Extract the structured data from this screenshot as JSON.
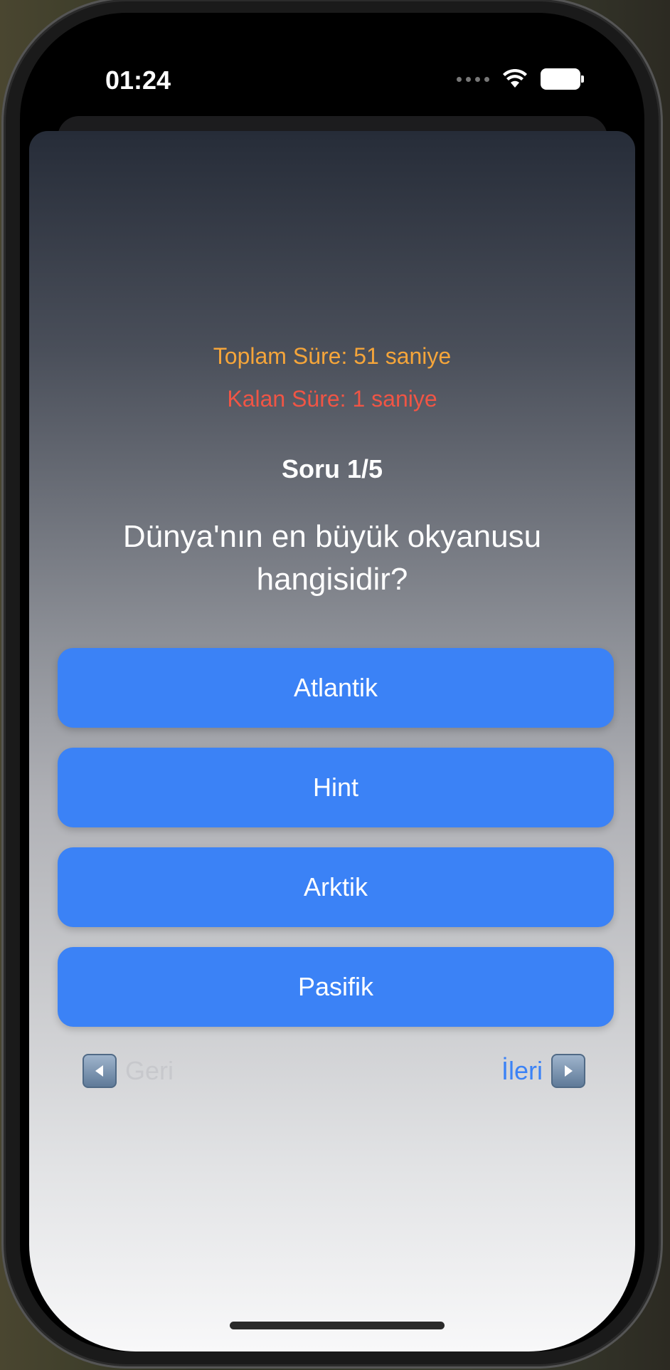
{
  "status_bar": {
    "time": "01:24",
    "wifi_icon": "wifi-icon",
    "battery_icon": "battery-icon"
  },
  "quiz": {
    "total_time": "Toplam Süre: 51 saniye",
    "remaining_time": "Kalan Süre: 1 saniye",
    "counter": "Soru 1/5",
    "question": "Dünya'nın en büyük okyanusu hangisidir?",
    "answers": [
      "Atlantik",
      "Hint",
      "Arktik",
      "Pasifik"
    ]
  },
  "navigation": {
    "back_label": "Geri",
    "next_label": "İleri",
    "back_icon": "left-arrow-icon",
    "next_icon": "right-arrow-icon"
  },
  "colors": {
    "accent": "#3b82f6",
    "total_time": "#f5a53a",
    "remaining_time": "#f05545",
    "disabled": "#c7c8cc"
  }
}
